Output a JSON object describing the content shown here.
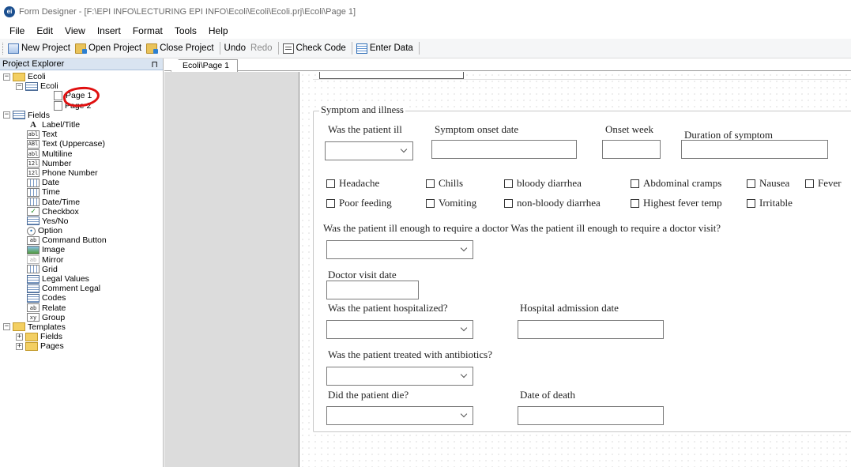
{
  "window": {
    "title": "Form Designer - [F:\\EPI INFO\\LECTURING EPI INFO\\Ecoli\\Ecoli\\Ecoli.prj\\Ecoli\\Page 1]",
    "app_icon_text": "ei"
  },
  "menu": [
    "File",
    "Edit",
    "View",
    "Insert",
    "Format",
    "Tools",
    "Help"
  ],
  "toolbar": {
    "new_project": "New Project",
    "open_project": "Open Project",
    "close_project": "Close Project",
    "undo": "Undo",
    "redo": "Redo",
    "check_code": "Check Code",
    "enter_data": "Enter Data"
  },
  "explorer": {
    "title": "Project Explorer",
    "pin_glyph": "⊓",
    "project": "Ecoli",
    "view": "Ecoli",
    "pages": [
      "Page 1",
      "Page 2"
    ],
    "fields_label": "Fields",
    "fields": [
      {
        "label": "Label/Title",
        "icon": "A"
      },
      {
        "label": "Text",
        "icon": "abl"
      },
      {
        "label": "Text (Uppercase)",
        "icon": "ABl"
      },
      {
        "label": "Multiline",
        "icon": "abl"
      },
      {
        "label": "Number",
        "icon": "12l"
      },
      {
        "label": "Phone Number",
        "icon": "12l"
      },
      {
        "label": "Date",
        "icon": ""
      },
      {
        "label": "Time",
        "icon": ""
      },
      {
        "label": "Date/Time",
        "icon": ""
      },
      {
        "label": "Checkbox",
        "icon": "✓"
      },
      {
        "label": "Yes/No",
        "icon": ""
      },
      {
        "label": "Option",
        "icon": "•"
      },
      {
        "label": "Command Button",
        "icon": "ab"
      },
      {
        "label": "Image",
        "icon": ""
      },
      {
        "label": "Mirror",
        "icon": "ab"
      },
      {
        "label": "Grid",
        "icon": ""
      },
      {
        "label": "Legal Values",
        "icon": ""
      },
      {
        "label": "Comment Legal",
        "icon": ""
      },
      {
        "label": "Codes",
        "icon": ""
      },
      {
        "label": "Relate",
        "icon": "ab"
      },
      {
        "label": "Group",
        "icon": "xy"
      }
    ],
    "templates_label": "Templates",
    "templates": [
      "Fields",
      "Pages"
    ],
    "expand_minus": "−",
    "expand_plus": "+"
  },
  "document_tab": "Ecoli\\Page 1",
  "form": {
    "group_title": "Symptom and illness",
    "was_ill_label": "Was the patient ill",
    "onset_date_label": "Symptom onset date",
    "onset_week_label": "Onset week",
    "duration_label": "Duration of symptom",
    "checkboxes_row1": [
      "Headache",
      "Chills",
      "bloody diarrhea",
      "Abdominal cramps",
      "Nausea",
      "Fever"
    ],
    "checkboxes_row2": [
      "Poor feeding",
      "Vomiting",
      "non-bloody diarrhea",
      "Highest fever temp",
      "Irritable"
    ],
    "doctor_question": "Was the patient ill enough to require a doctor Was the patient ill enough to require a doctor visit?",
    "doctor_visit_date_label": "Doctor visit date",
    "hospitalized_label": "Was the patient hospitalized?",
    "admission_date_label": "Hospital admission date",
    "antibiotics_label": "Was the patient treated with antibiotics?",
    "died_label": "Did the patient die?",
    "death_date_label": "Date of death"
  },
  "colors": {
    "annotation_circle": "#e01010",
    "explorer_header": "#d9e4f1"
  }
}
